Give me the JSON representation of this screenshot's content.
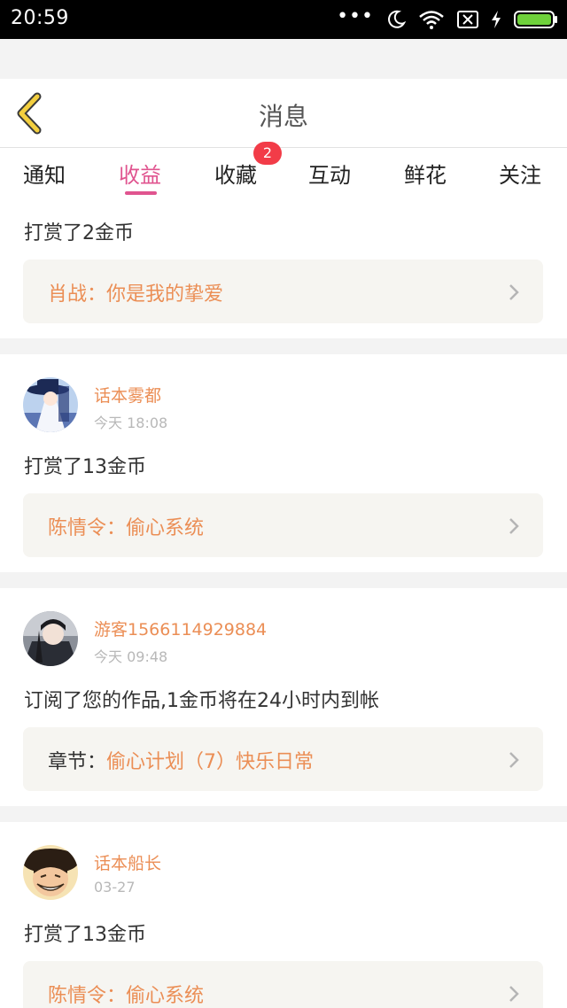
{
  "status_bar": {
    "time": "20:59",
    "dots": "•••"
  },
  "header": {
    "title": "消息"
  },
  "tabs": [
    {
      "label": "通知",
      "active": false
    },
    {
      "label": "收益",
      "active": true
    },
    {
      "label": "收藏",
      "active": false,
      "badge": "2"
    },
    {
      "label": "互动",
      "active": false
    },
    {
      "label": "鲜花",
      "active": false
    },
    {
      "label": "关注",
      "active": false
    }
  ],
  "messages": [
    {
      "action": "打赏了2金币",
      "ref_text": "肖战：你是我的挚爱"
    },
    {
      "user": "话本雾都",
      "time": "今天 18:08",
      "action": "打赏了13金币",
      "ref_text": "陈情令：偷心系统"
    },
    {
      "user": "游客1566114929884",
      "time": "今天 09:48",
      "action": "订阅了您的作品,1金币将在24小时内到帐",
      "ref_prefix": "章节：",
      "ref_text": "偷心计划（7）快乐日常"
    },
    {
      "user": "话本船长",
      "time": "03-27",
      "action": "打赏了13金币",
      "ref_text": "陈情令：偷心系统"
    }
  ],
  "colors": {
    "accent": "#e0548f",
    "name_orange": "#eb8e55",
    "badge_red": "#f23c48",
    "back_yellow": "#f3cf3f"
  }
}
